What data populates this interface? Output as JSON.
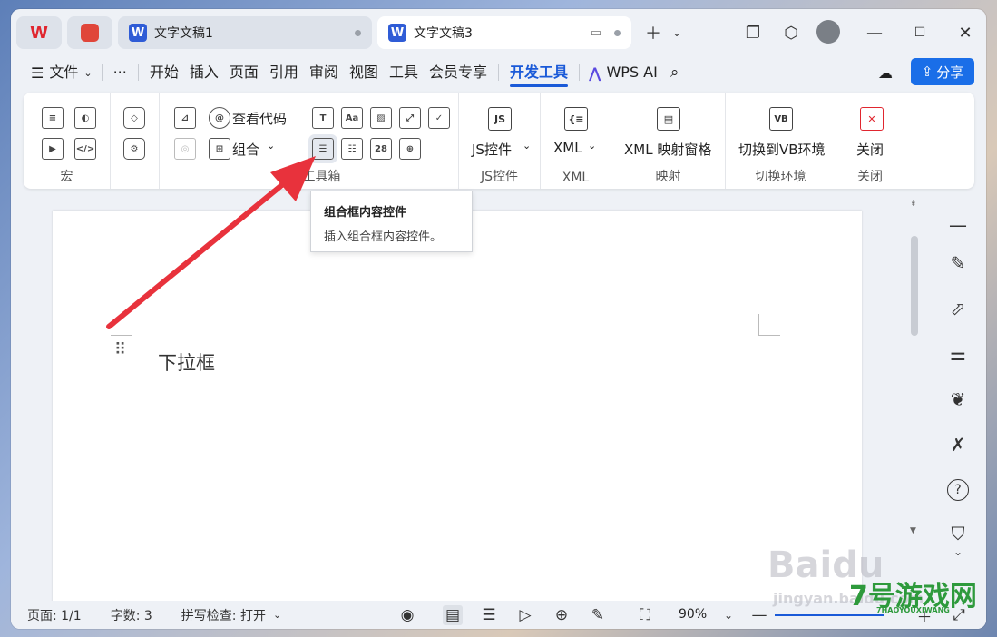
{
  "tabs": {
    "doc1": "文字文稿1",
    "doc3": "文字文稿3"
  },
  "menu": {
    "file": "文件",
    "more": "···",
    "items": [
      "开始",
      "插入",
      "页面",
      "引用",
      "审阅",
      "视图",
      "工具",
      "会员专享"
    ],
    "active": "开发工具",
    "wps_ai": "WPS AI",
    "share": "分享"
  },
  "ribbon": {
    "macro_group": "宏",
    "view_code": "查看代码",
    "combine": "组合",
    "toolbox_group": "控件工具箱",
    "js_control": "JS控件",
    "js_group": "JS控件",
    "xml_button": "XML",
    "xml_group": "XML",
    "xml_map_pane": "XML 映射窗格",
    "map_group": "映射",
    "switch_vb": "切换到VB环境",
    "switch_group": "切换环境",
    "close_button": "关闭",
    "close_group": "关闭"
  },
  "tooltip": {
    "title": "组合框内容控件",
    "desc": "插入组合框内容控件。"
  },
  "document": {
    "text": "下拉框"
  },
  "status": {
    "page": "页面: 1/1",
    "words": "字数: 3",
    "spell": "拼写检查: 打开",
    "zoom": "90%"
  },
  "watermarks": {
    "baidu": "Baidu",
    "jingyan": "jingyan.baidu.com",
    "site": "7号游戏网",
    "site_small": "7HAOYOUXIWANG"
  },
  "colors": {
    "accent": "#1a5ad8",
    "arrow": "#e8323c",
    "share_bg": "#1a6ee8"
  }
}
